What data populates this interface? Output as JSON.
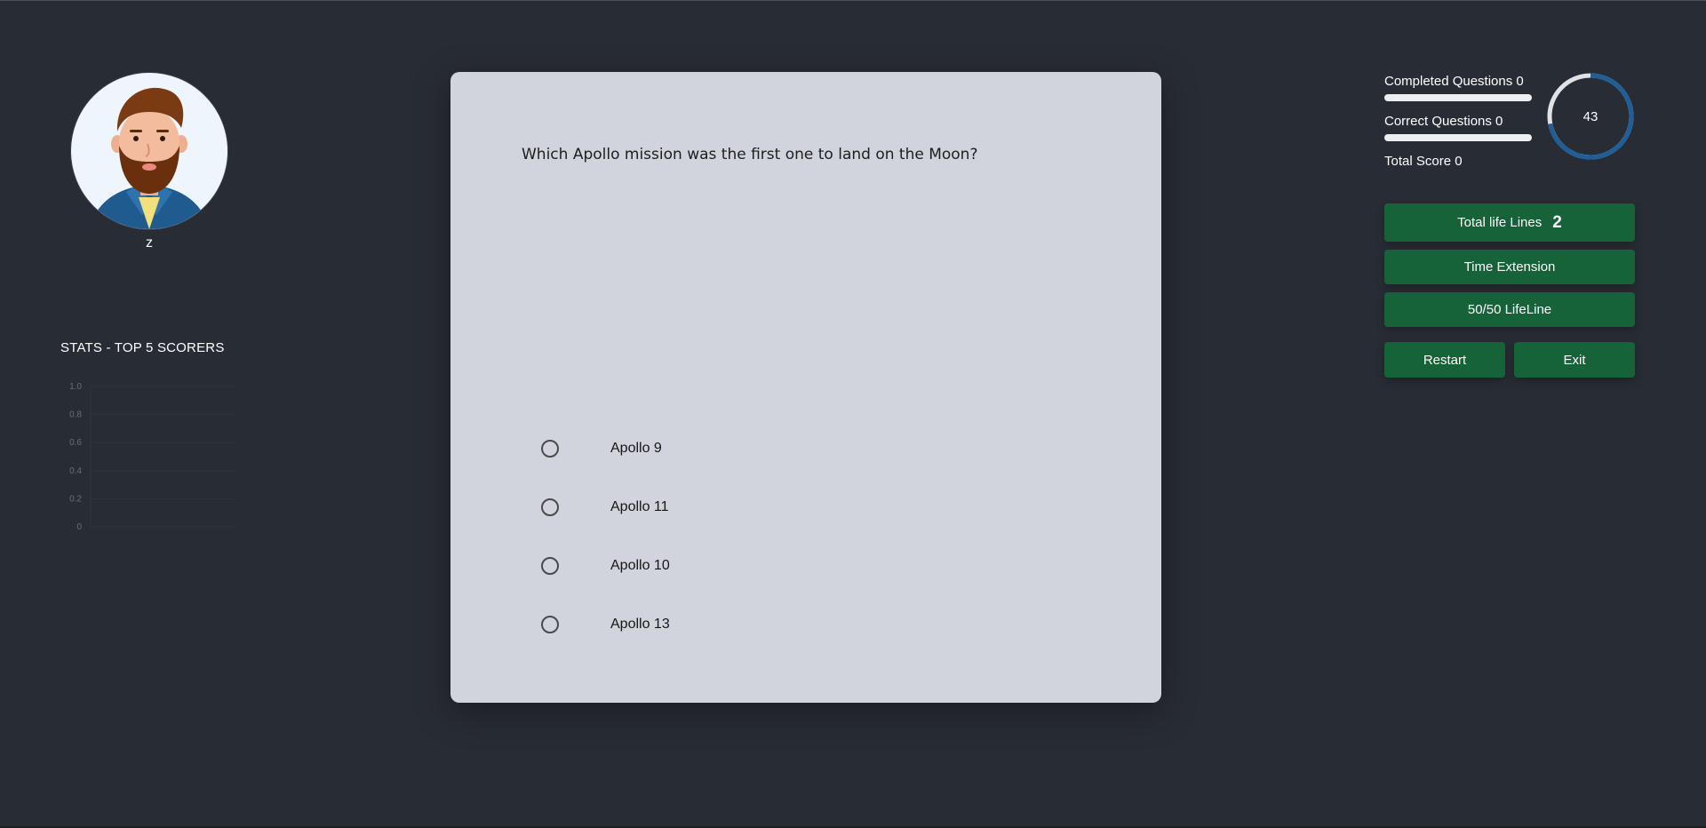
{
  "profile": {
    "username": "z",
    "avatar_icon": "bearded-man-avatar-icon"
  },
  "stats": {
    "title": "STATS - TOP 5 SCORERS"
  },
  "chart_data": {
    "type": "bar",
    "title": "STATS - TOP 5 SCORERS",
    "categories": [],
    "values": [],
    "ylim": [
      0,
      1.0
    ],
    "yticks": [
      "0",
      "0.2",
      "0.4",
      "0.6",
      "0.8",
      "1.0"
    ],
    "grid": true
  },
  "quiz": {
    "question": "Which Apollo mission was the first one to land on the Moon?",
    "options": [
      {
        "label": "Apollo 9"
      },
      {
        "label": "Apollo 11"
      },
      {
        "label": "Apollo 10"
      },
      {
        "label": "Apollo 13"
      }
    ]
  },
  "progress": {
    "completed_label": "Completed Questions 0",
    "completed_fraction": 0,
    "correct_label": "Correct Questions 0",
    "correct_fraction": 0,
    "score_label": "Total Score 0"
  },
  "timer": {
    "value": "43",
    "fraction_remaining": 0.72,
    "ring_color": "#1f5f99",
    "track_color": "#e0e2e6"
  },
  "buttons": {
    "lifelines_label": "Total life Lines",
    "lifelines_count": "2",
    "time_extension": "Time Extension",
    "fifty_fifty": "50/50 LifeLine",
    "restart": "Restart",
    "exit": "Exit",
    "button_color": "#176339"
  }
}
